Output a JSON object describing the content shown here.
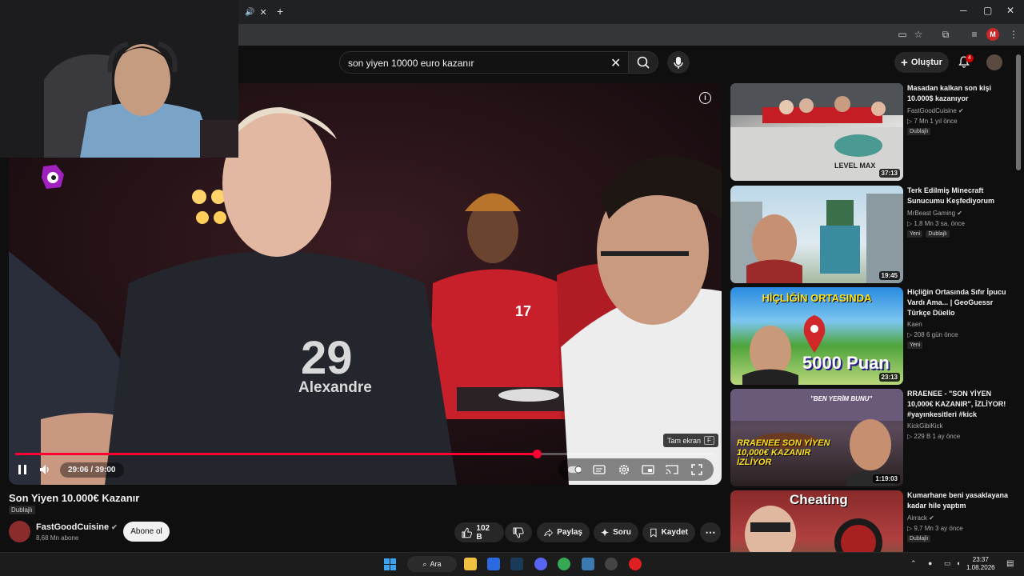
{
  "browser": {
    "new_tab_symbol": "+",
    "tab_close_symbol": "✕",
    "minimize": "─",
    "maximize": "▢",
    "close": "✕",
    "profile_initial": "M"
  },
  "header": {
    "search_value": "son yiyen 10000 euro kazanır",
    "create_label": "Oluştur",
    "notification_count": "4"
  },
  "player": {
    "time_current": "29:06",
    "time_total": "39:00",
    "time_display": "29:06 / 39:00",
    "progress_fraction": 0.746,
    "fullscreen_tip": "Tam ekran",
    "fullscreen_key": "F",
    "info_symbol": "i",
    "jersey_number": "29",
    "jersey_name": "Alexandre",
    "shirt_number_2": "17"
  },
  "video": {
    "title": "Son Yiyen 10.000€ Kazanır",
    "dub_badge": "Dublajlı",
    "channel_name": "FastGoodCuisine",
    "subscribers": "8,68 Mn abone",
    "subscribe_label": "Abone ol",
    "like_count": "102 B",
    "share_label": "Paylaş",
    "ask_label": "Soru",
    "save_label": "Kaydet"
  },
  "recommendations": [
    {
      "title": "Masadan kalkan son kişi 10.000$ kazanıyor",
      "channel": "FastGoodCuisine",
      "meta": "▷ 7 Mn   1 yıl önce",
      "badges": [
        "Dublajlı"
      ],
      "duration": "37:13",
      "thumb_text": "LEVEL MAX"
    },
    {
      "title": "Terk Edilmiş Minecraft Sunucumu Keşfediyorum",
      "channel": "MrBeast Gaming",
      "meta": "▷ 1,8 Mn   3 sa. önce",
      "badges": [
        "Yeni",
        "Dublajlı"
      ],
      "duration": "19:45",
      "thumb_text": ""
    },
    {
      "title": "Hiçliğin Ortasında Sıfır İpucu Vardı Ama... | GeoGuessr Türkçe Düello",
      "channel": "Kaen",
      "meta": "▷ 208   6 gün önce",
      "badges": [
        "Yeni"
      ],
      "duration": "23:13",
      "thumb_text": "HİÇLİĞİN ORTASINDA",
      "thumb_text2": "5000 Puan"
    },
    {
      "title": "RRAENEE - \"SON YİYEN 10,000€ KAZANIR\", İZLİYOR! #yayınkesitleri #kick",
      "channel": "KickGibiKick",
      "meta": "▷ 229 B   1 ay önce",
      "badges": [],
      "duration": "1:19:03",
      "thumb_text": "\"BEN YERİM BUNU\"",
      "thumb_text2": "RRAENEE SON YİYEN 10,000€ KAZANIR İZLİYOR"
    },
    {
      "title": "Kumarhane beni yasaklayana kadar hile yaptım",
      "channel": "Airrack",
      "meta": "▷ 9,7 Mn   3 ay önce",
      "badges": [
        "Dublajlı"
      ],
      "duration": "",
      "thumb_text": "Cheating"
    }
  ],
  "taskbar": {
    "search_label": "Ara",
    "time": "23:37",
    "date": "1.08.2026"
  },
  "colors": {
    "accent_red": "#ff0033",
    "background": "#0f0f0f"
  }
}
